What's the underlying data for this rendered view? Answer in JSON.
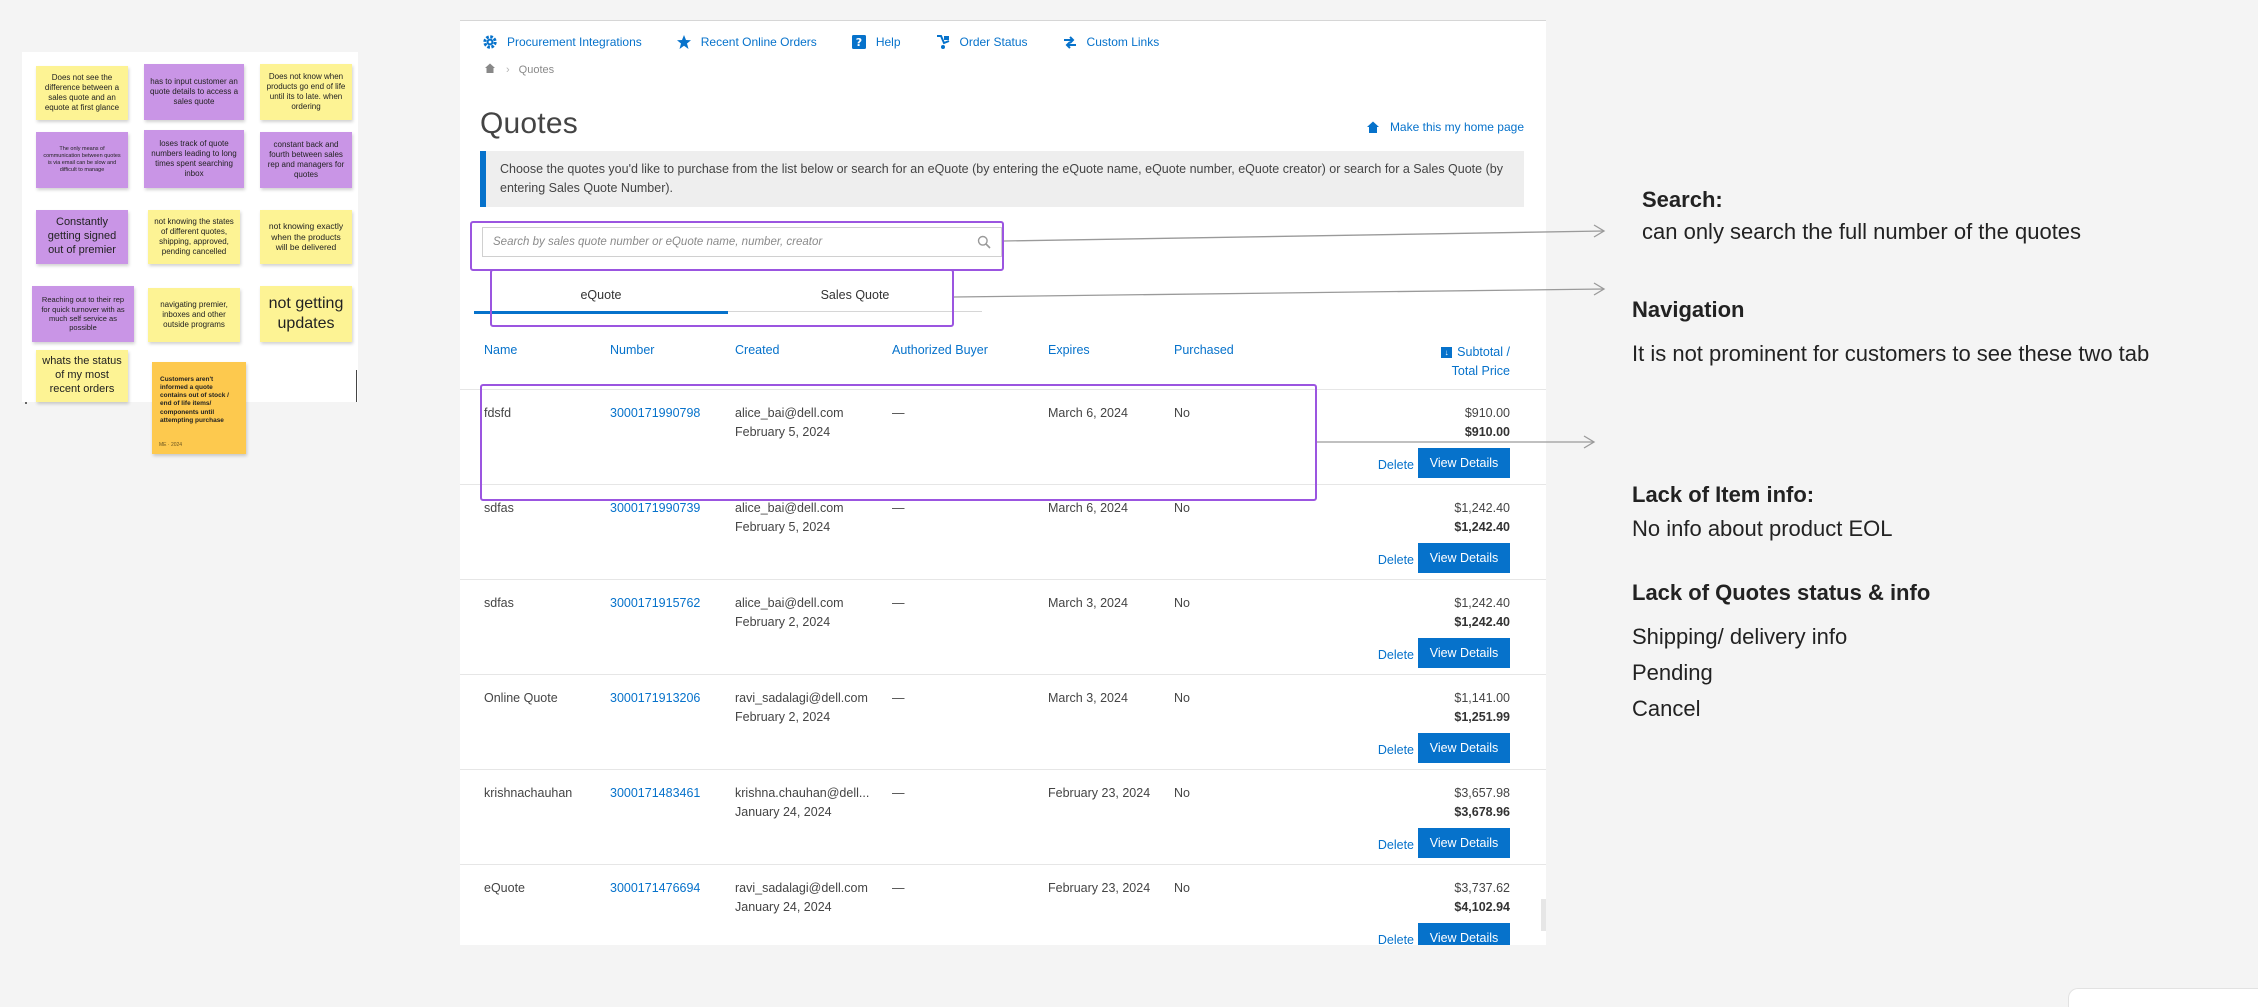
{
  "sticky_notes": [
    {
      "text": "Does not see the difference between a sales quote and an equote at first glance",
      "color": "yellow"
    },
    {
      "text": "has to input customer an quote details to access a sales quote",
      "color": "purple"
    },
    {
      "text": "Does not know when products go end of life until its to late. when ordering",
      "color": "yellow"
    },
    {
      "text": "The only means of communication between quotes is via email can be slow and difficult to manage",
      "color": "purple"
    },
    {
      "text": "loses track of quote numbers leading to long times spent searching inbox",
      "color": "purple"
    },
    {
      "text": "constant back and fourth between sales rep and managers for quotes",
      "color": "purple"
    },
    {
      "text": "Constantly getting signed out of premier",
      "color": "purple"
    },
    {
      "text": "not knowing the states of different quotes, shipping, approved, pending cancelled",
      "color": "yellow"
    },
    {
      "text": "not knowing exactly when the products will be delivered",
      "color": "yellow"
    },
    {
      "text": "Reaching out to their rep for quick turnover with as much self service as possible",
      "color": "purple"
    },
    {
      "text": "navigating premier, inboxes and other outside programs",
      "color": "yellow"
    },
    {
      "text": "not getting updates",
      "color": "yellow"
    },
    {
      "text": "whats the status of my most recent orders",
      "color": "yellow"
    },
    {
      "text": "Customers aren't informed a quote contains out of stock / end of life items/ components until attempting purchase",
      "color": "orange",
      "footer": "ME · 2024"
    }
  ],
  "top_nav": [
    {
      "label": "Procurement Integrations",
      "icon": "gear-icon"
    },
    {
      "label": "Recent Online Orders",
      "icon": "star-icon"
    },
    {
      "label": "Help",
      "icon": "help-icon"
    },
    {
      "label": "Order Status",
      "icon": "truck-icon"
    },
    {
      "label": "Custom Links",
      "icon": "link-icon"
    }
  ],
  "breadcrumb": {
    "current": "Quotes"
  },
  "page": {
    "title": "Quotes",
    "home_link": "Make this my home page",
    "info": "Choose the quotes you'd like to purchase from the list below or search for an eQuote (by entering the eQuote name, eQuote number, eQuote creator) or search for a Sales Quote (by entering Sales Quote Number)."
  },
  "search": {
    "placeholder": "Search by sales quote number or eQuote name, number, creator"
  },
  "tabs": [
    {
      "label": "eQuote",
      "active": true
    },
    {
      "label": "Sales Quote",
      "active": false
    }
  ],
  "table": {
    "columns": [
      "Name",
      "Number",
      "Created",
      "Authorized Buyer",
      "Expires",
      "Purchased"
    ],
    "price_header_1": "Subtotal /",
    "price_header_2": "Total Price",
    "delete_label": "Delete",
    "view_label": "View Details",
    "rows": [
      {
        "name": "fdsfd",
        "number": "3000171990798",
        "email": "alice_bai@dell.com",
        "date": "February 5, 2024",
        "buyer": "—",
        "expires": "March 6, 2024",
        "purchased": "No",
        "subtotal": "$910.00",
        "total": "$910.00"
      },
      {
        "name": "sdfas",
        "number": "3000171990739",
        "email": "alice_bai@dell.com",
        "date": "February 5, 2024",
        "buyer": "—",
        "expires": "March 6, 2024",
        "purchased": "No",
        "subtotal": "$1,242.40",
        "total": "$1,242.40"
      },
      {
        "name": "sdfas",
        "number": "3000171915762",
        "email": "alice_bai@dell.com",
        "date": "February 2, 2024",
        "buyer": "—",
        "expires": "March 3, 2024",
        "purchased": "No",
        "subtotal": "$1,242.40",
        "total": "$1,242.40"
      },
      {
        "name": "Online Quote",
        "number": "3000171913206",
        "email": "ravi_sadalagi@dell.com",
        "date": "February 2, 2024",
        "buyer": "—",
        "expires": "March 3, 2024",
        "purchased": "No",
        "subtotal": "$1,141.00",
        "total": "$1,251.99"
      },
      {
        "name": "krishnachauhan",
        "number": "3000171483461",
        "email": "krishna.chauhan@dell...",
        "date": "January 24, 2024",
        "buyer": "—",
        "expires": "February 23, 2024",
        "purchased": "No",
        "subtotal": "$3,657.98",
        "total": "$3,678.96"
      },
      {
        "name": "eQuote",
        "number": "3000171476694",
        "email": "ravi_sadalagi@dell.com",
        "date": "January 24, 2024",
        "buyer": "—",
        "expires": "February 23, 2024",
        "purchased": "No",
        "subtotal": "$3,737.62",
        "total": "$4,102.94"
      }
    ]
  },
  "annotations": {
    "search": {
      "heading": "Search:",
      "text": "can only search the full number of the quotes"
    },
    "navigation": {
      "heading": "Navigation",
      "text": "It is not prominent for customers to see these two tab"
    },
    "item_info": {
      "heading": "Lack of Item info:",
      "text": "No info about product EOL"
    },
    "quotes_status": {
      "heading": "Lack of Quotes status & info",
      "lines": [
        "Shipping/ delivery info",
        "Pending",
        "Cancel"
      ]
    }
  },
  "colors": {
    "brand_blue": "#0672cb",
    "highlight_purple": "#9b55e0",
    "note_yellow": "#fdf394",
    "note_purple": "#c995e6",
    "note_orange": "#fdc94e"
  }
}
